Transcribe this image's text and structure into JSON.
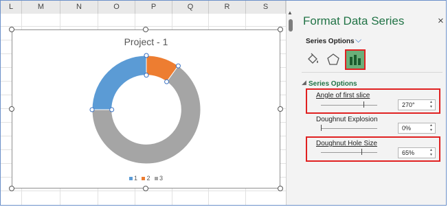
{
  "spreadsheet": {
    "columns": [
      "L",
      "M",
      "N",
      "O",
      "P",
      "Q",
      "R",
      "S"
    ]
  },
  "chart": {
    "title": "Project - 1",
    "legend": [
      {
        "label": "1",
        "color": "#5b9bd5"
      },
      {
        "label": "2",
        "color": "#ed7d31"
      },
      {
        "label": "3",
        "color": "#a5a5a5"
      }
    ]
  },
  "chart_data": {
    "type": "doughnut",
    "title": "Project - 1",
    "series": [
      {
        "values": [
          25,
          10,
          65
        ]
      }
    ],
    "categories": [
      "1",
      "2",
      "3"
    ],
    "colors": [
      "#5b9bd5",
      "#ed7d31",
      "#a5a5a5"
    ],
    "start_angle_deg": 270,
    "hole_size_pct": 65,
    "legend_position": "bottom"
  },
  "pane": {
    "title": "Format Data Series",
    "close_glyph": "×",
    "series_options_label": "Series Options",
    "section_header": "Series Options",
    "icons": [
      "fill-line-icon",
      "effects-icon",
      "series-options-icon"
    ],
    "angle": {
      "label": "Angle of first slice",
      "value": "270°",
      "slider_fraction": 0.75
    },
    "explosion": {
      "label": "Doughnut Explosion",
      "value": "0%",
      "slider_fraction": 0.0
    },
    "hole": {
      "label": "Doughnut Hole Size",
      "value": "65%",
      "slider_fraction": 0.72
    }
  },
  "highlight_color": "#e02020",
  "accent_color": "#217346"
}
